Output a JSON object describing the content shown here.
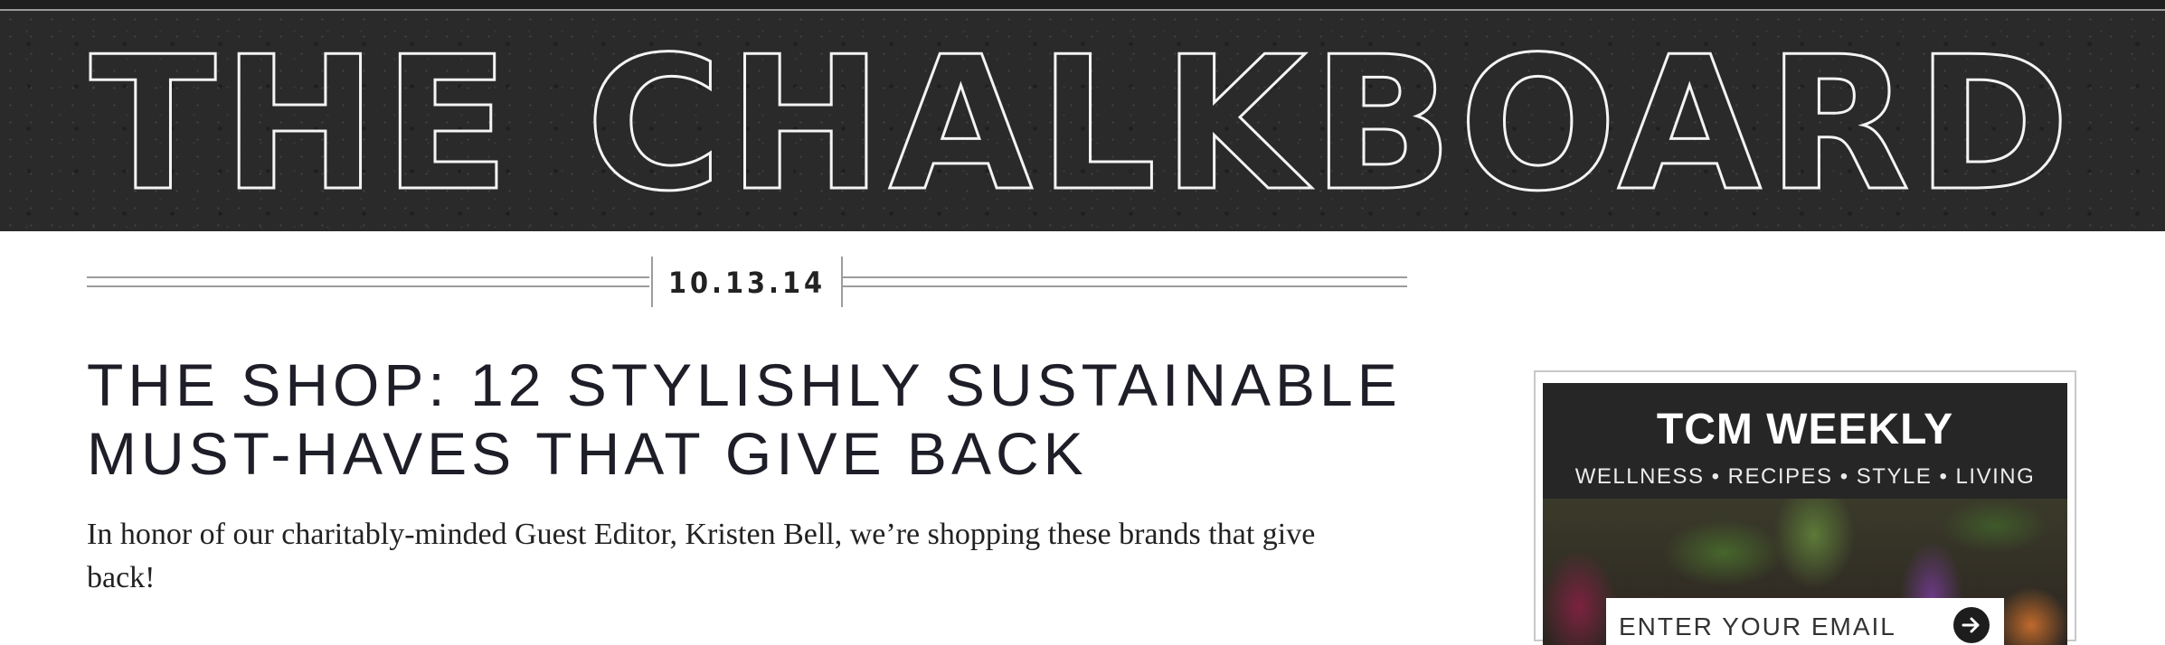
{
  "masthead": {
    "logo_text": "THE CHALKBOARD"
  },
  "post": {
    "date": "10.13.14",
    "title_line1": "THE SHOP: 12 STYLISHLY SUSTAINABLE",
    "title_line2": "MUST-HAVES THAT GIVE BACK",
    "lede_line1": "In honor of our charitably-minded Guest Editor, Kristen Bell, we’re shopping these brands that give",
    "lede_line2": "back!"
  },
  "newsletter": {
    "title": "TCM WEEKLY",
    "subtitle": "WELLNESS • RECIPES • STYLE • LIVING",
    "email_placeholder": "ENTER YOUR EMAIL",
    "submit_icon": "arrow-right-icon"
  },
  "colors": {
    "masthead_bg": "#2a2a2a",
    "outline_text": "#f4f4f4",
    "body_text": "#1e1e28"
  }
}
